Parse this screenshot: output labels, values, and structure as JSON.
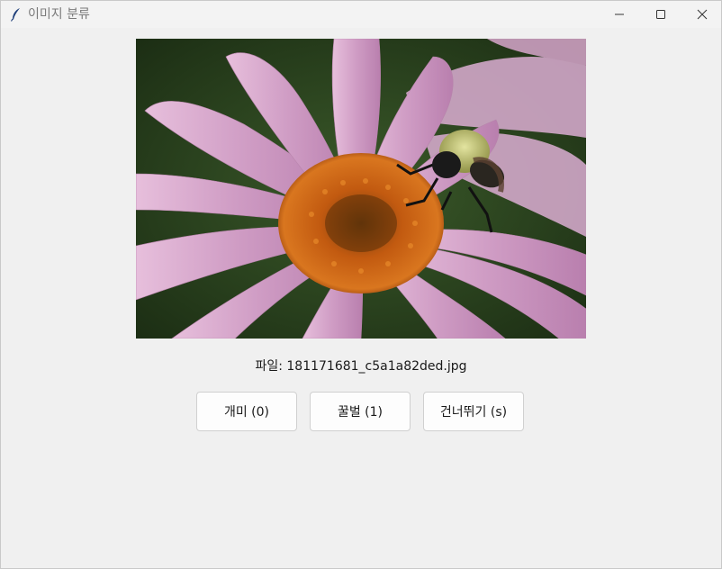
{
  "window": {
    "title": "이미지 분류",
    "icon": "feather-icon",
    "controls": [
      "minimize-icon",
      "maximize-icon",
      "close-icon"
    ]
  },
  "image": {
    "description_icon": "flower-bee-photo"
  },
  "file_label": "파일: 181171681_c5a1a82ded.jpg",
  "buttons": {
    "ant": "개미 (0)",
    "bee": "꿀벌 (1)",
    "skip": "건너뛰기 (s)"
  }
}
